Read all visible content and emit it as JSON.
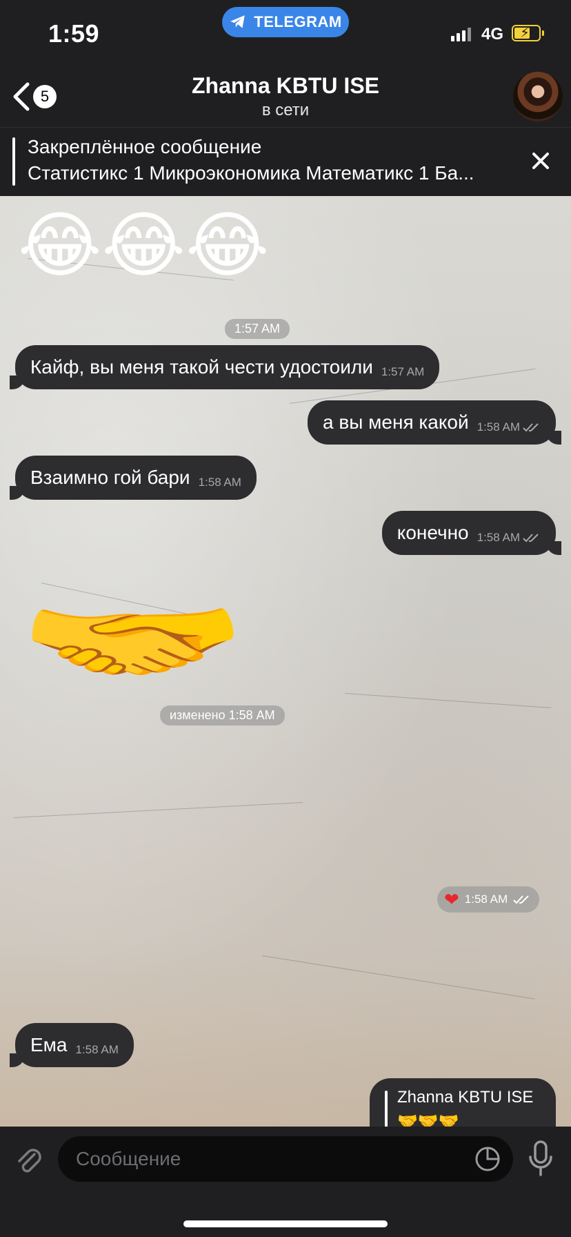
{
  "status_bar": {
    "time": "1:59",
    "app_pill": "TELEGRAM",
    "network": "4G"
  },
  "header": {
    "unread_count": "5",
    "title": "Zhanna KBTU ISE",
    "status": "в сети"
  },
  "pinned": {
    "title": "Закреплённое сообщение",
    "text": "Статистикс 1 Микроэкономика Математикс 1 Ба..."
  },
  "chat": {
    "emoji_message": "😂😂😂",
    "date_pill": "1:57 AM",
    "messages": [
      {
        "dir": "in",
        "text": "Кайф, вы меня такой чести удостоили",
        "time": "1:57 AM"
      },
      {
        "dir": "out",
        "text": "а вы меня какой",
        "time": "1:58 AM"
      },
      {
        "dir": "in",
        "text": "Взаимно гой бари",
        "time": "1:58 AM"
      },
      {
        "dir": "out",
        "text": "конечно",
        "time": "1:58 AM"
      }
    ],
    "sticker": "🤝",
    "edited_pill": "изменено 1:58 AM",
    "reaction": {
      "emoji": "❤",
      "time": "1:58 AM"
    },
    "last_in": {
      "text": "Ема",
      "time": "1:58 AM"
    },
    "quote": {
      "name": "Zhanna KBTU ISE",
      "text": "🤝🤝🤝"
    }
  },
  "input": {
    "placeholder": "Сообщение"
  },
  "colors": {
    "accent": "#3a85e8",
    "bubble": "#2d2d2f",
    "bar": "#1f1f21"
  }
}
